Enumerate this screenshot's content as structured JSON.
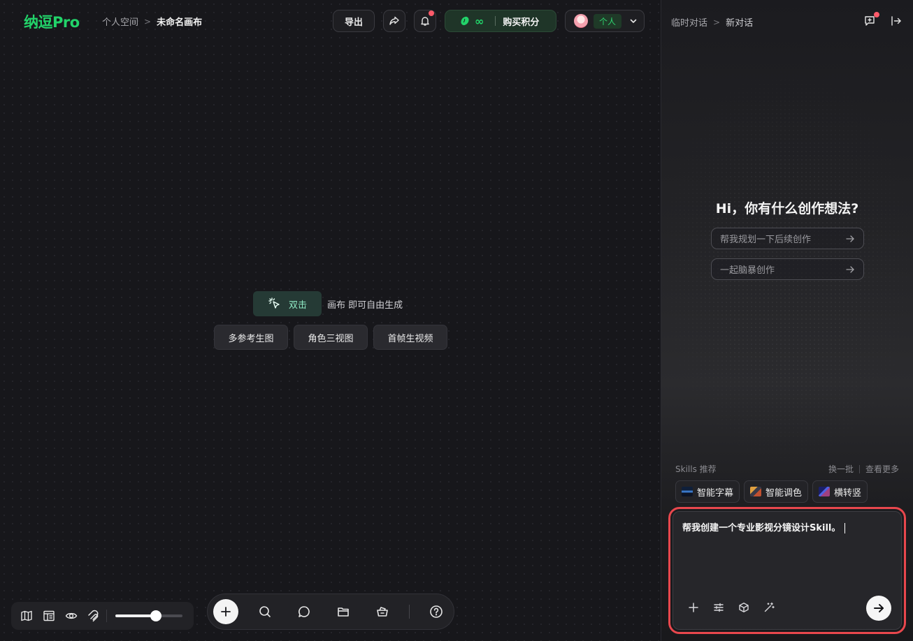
{
  "app": {
    "logo": "纳逗Pro",
    "breadcrumb": {
      "space": "个人空间",
      "separator": ">",
      "canvas": "未命名画布"
    }
  },
  "header": {
    "export_label": "导出",
    "credits": {
      "symbol": "∞",
      "buy_label": "购买积分"
    },
    "account": {
      "tag": "个人"
    }
  },
  "canvas": {
    "hint": {
      "chip_label": "双击",
      "text": "画布 即可自由生成"
    },
    "quick_actions": [
      "多参考生图",
      "角色三视图",
      "首帧生视频"
    ],
    "zoom_level": 0.6
  },
  "panel": {
    "breadcrumb": {
      "root": "临时对话",
      "separator": ">",
      "current": "新对话"
    },
    "greeting": "Hi，你有什么创作想法?",
    "suggestions": [
      "帮我规划一下后续创作",
      "一起脑暴创作"
    ],
    "skills": {
      "title": "Skills 推荐",
      "refresh": "换一批",
      "more": "查看更多",
      "items": [
        "智能字幕",
        "智能调色",
        "横转竖"
      ]
    },
    "input": {
      "value": "帮我创建一个专业影视分镜设计Skill。"
    }
  },
  "colors": {
    "brand": "#22d46a",
    "highlight": "#e8474d",
    "notification": "#ff5a6a"
  }
}
